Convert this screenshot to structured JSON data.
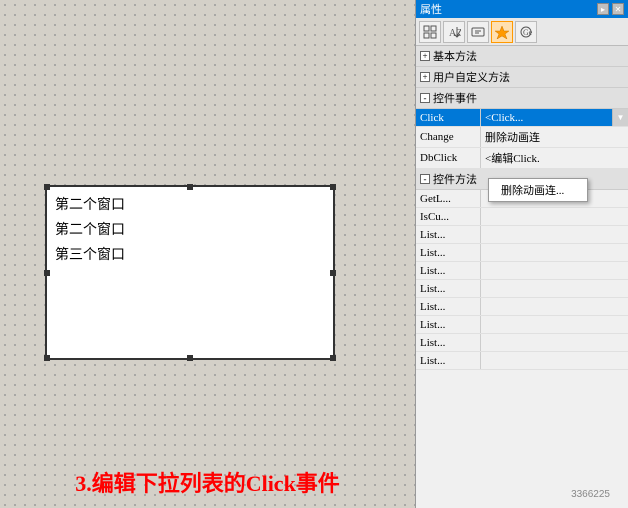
{
  "canvas": {
    "background": "dotted",
    "listbox": {
      "items": [
        "第二个窗口",
        "第二个窗口",
        "第三个窗口"
      ]
    },
    "caption": "3.编辑下拉列表的Click事件"
  },
  "properties_panel": {
    "title": "属性",
    "toolbar_buttons": [
      "grid-icon",
      "sort-icon",
      "method-icon",
      "event-icon",
      "custom-icon"
    ],
    "sections": [
      {
        "id": "basic_methods",
        "label": "基本方法",
        "expanded": false,
        "rows": []
      },
      {
        "id": "custom_methods",
        "label": "用户自定义方法",
        "expanded": false,
        "rows": []
      },
      {
        "id": "control_events",
        "label": "控件事件",
        "expanded": true,
        "rows": [
          {
            "name": "Click",
            "value": "<Click...",
            "selected": true
          },
          {
            "name": "Change",
            "value": "删除动画连",
            "selected": false,
            "context": true
          },
          {
            "name": "DbClick",
            "value": "<编辑Click.",
            "selected": false
          }
        ]
      },
      {
        "id": "control_methods",
        "label": "控件方法",
        "expanded": true,
        "rows": [
          {
            "name": "GetL...",
            "value": ""
          },
          {
            "name": "IsCu...",
            "value": ""
          },
          {
            "name": "List...",
            "value": ""
          },
          {
            "name": "List...",
            "value": ""
          },
          {
            "name": "List...",
            "value": ""
          },
          {
            "name": "List...",
            "value": ""
          },
          {
            "name": "List...",
            "value": ""
          },
          {
            "name": "List...",
            "value": ""
          },
          {
            "name": "List...",
            "value": ""
          },
          {
            "name": "List...",
            "value": ""
          }
        ]
      }
    ]
  },
  "watermark": {
    "text": "3366225"
  },
  "icons": {
    "expand_plus": "+",
    "collapse_minus": "-",
    "pin": "▸",
    "close": "✕",
    "dropdown_arrow": "▼"
  }
}
